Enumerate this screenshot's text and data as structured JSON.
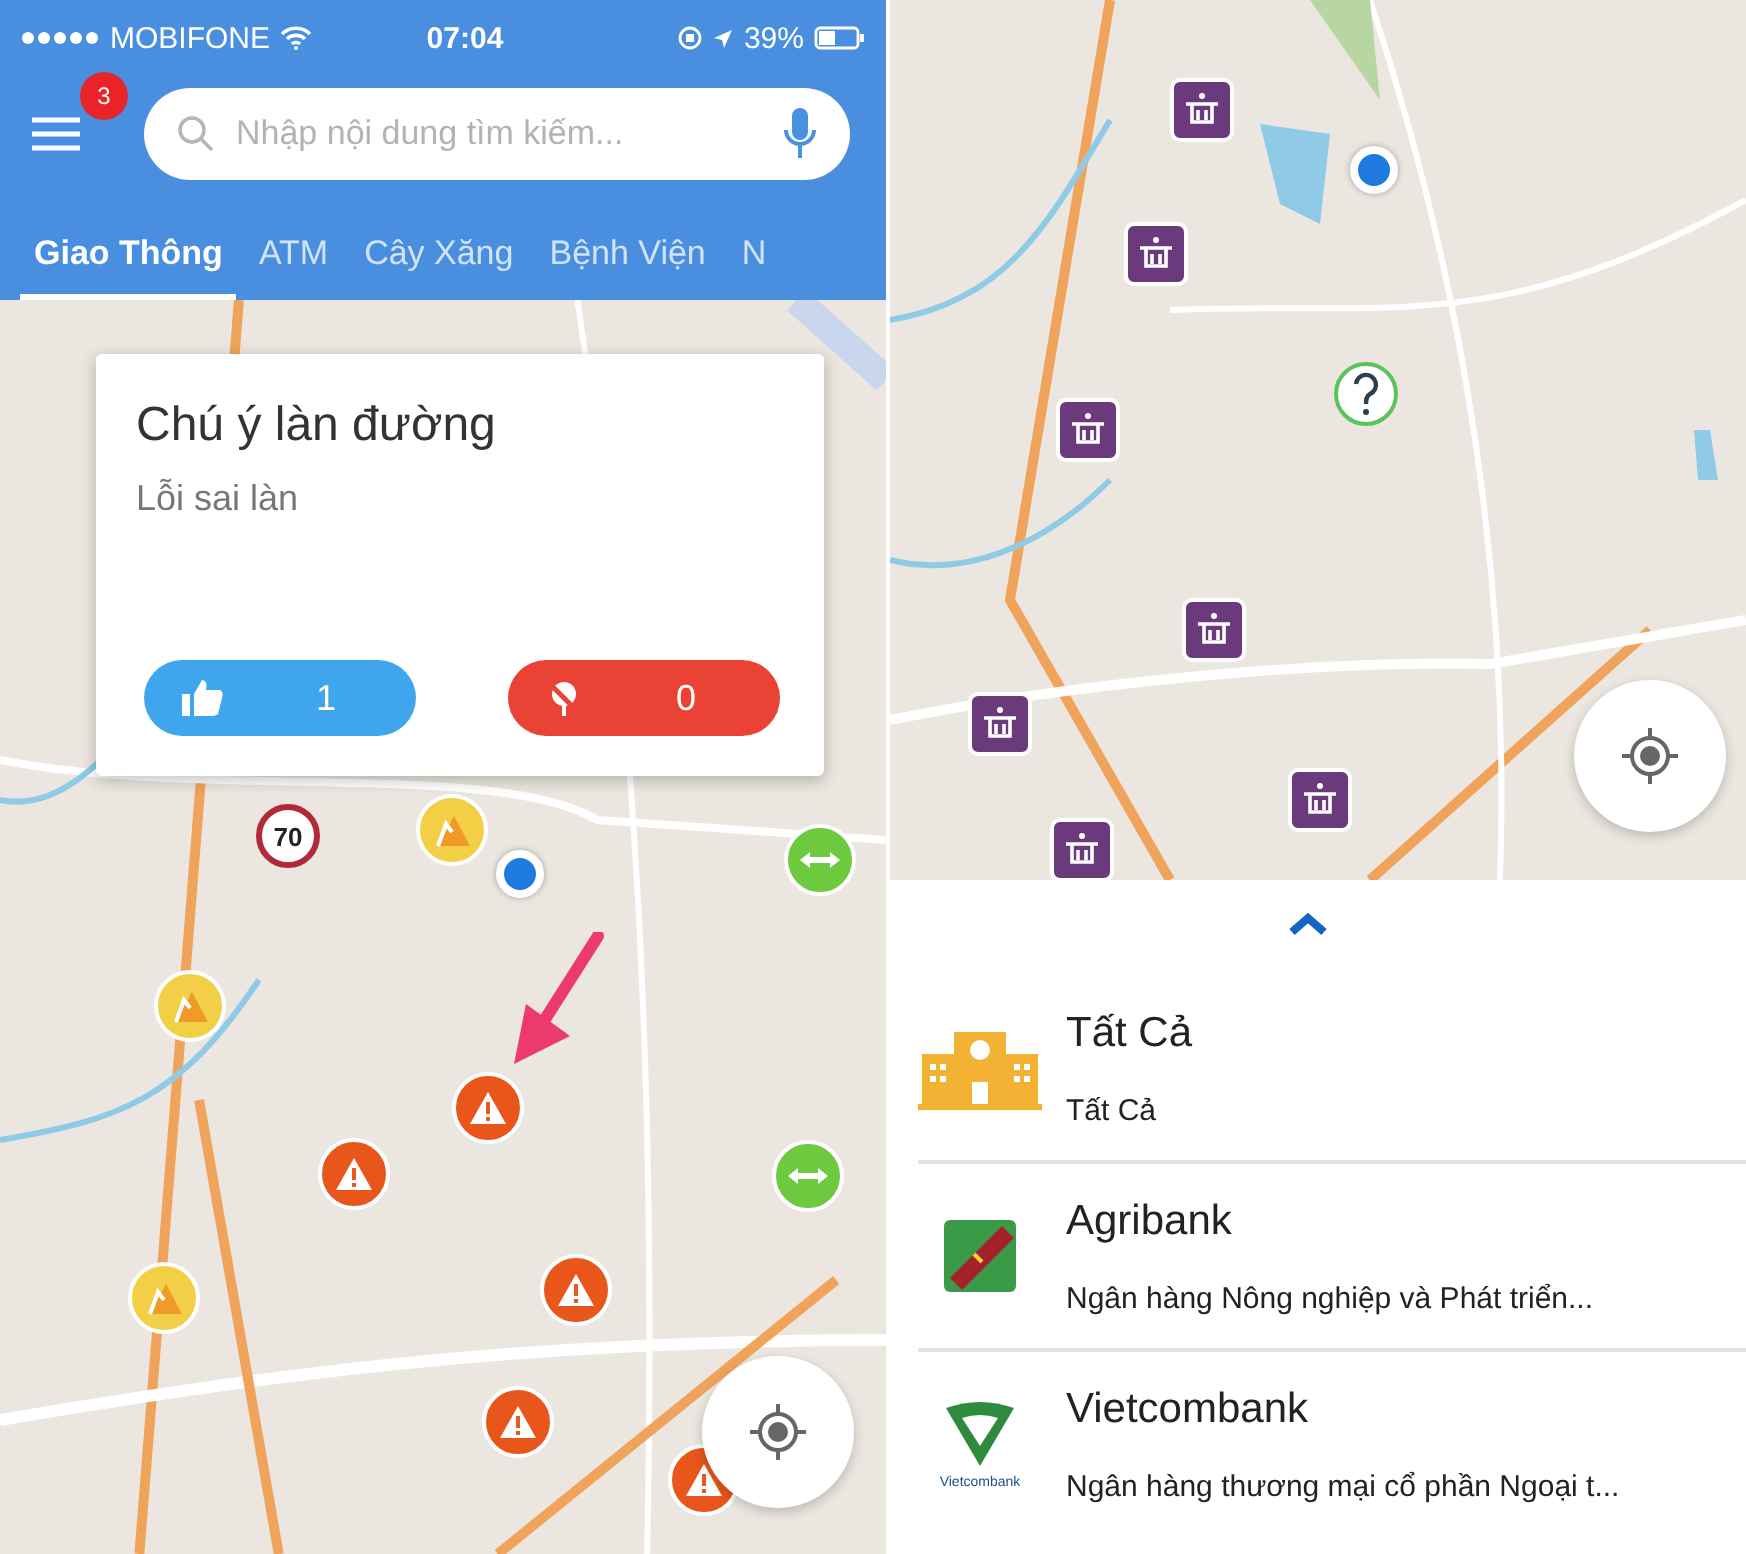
{
  "left_screen": {
    "status_bar": {
      "carrier": "MOBIFONE",
      "time": "07:04",
      "battery": "39%"
    },
    "menu_badge": "3",
    "search": {
      "placeholder": "Nhập nội dung tìm kiếm..."
    },
    "tabs": [
      {
        "label": "Giao Thông",
        "selected": true
      },
      {
        "label": "ATM",
        "selected": false
      },
      {
        "label": "Cây Xăng",
        "selected": false
      },
      {
        "label": "Bệnh Viện",
        "selected": false
      },
      {
        "label": "N",
        "selected": false
      }
    ],
    "map": {
      "kind": "picture",
      "markers": [
        {
          "kind": "speed-limit",
          "label": "70"
        },
        {
          "kind": "construction"
        },
        {
          "kind": "location"
        },
        {
          "kind": "traffic"
        },
        {
          "kind": "construction"
        },
        {
          "kind": "warning"
        },
        {
          "kind": "warning"
        },
        {
          "kind": "traffic"
        },
        {
          "kind": "construction"
        },
        {
          "kind": "warning"
        },
        {
          "kind": "warning"
        },
        {
          "kind": "warning"
        }
      ]
    },
    "popup": {
      "title": "Chú ý làn đường",
      "subtitle": "Lỗi sai làn",
      "like_count": "1",
      "dislike_count": "0"
    }
  },
  "right_screen": {
    "map": {
      "kind": "picture",
      "markers": [
        {
          "kind": "atm"
        },
        {
          "kind": "location"
        },
        {
          "kind": "atm"
        },
        {
          "kind": "unknown"
        },
        {
          "kind": "atm"
        },
        {
          "kind": "atm"
        },
        {
          "kind": "atm"
        },
        {
          "kind": "atm"
        },
        {
          "kind": "atm"
        }
      ]
    },
    "bank_list": {
      "items": [
        {
          "kind": "all",
          "name": "Tất Cả",
          "description": "Tất Cả"
        },
        {
          "kind": "agribank",
          "name": "Agribank",
          "description": "Ngân hàng Nông nghiệp và Phát triển..."
        },
        {
          "kind": "vietcombank",
          "name": "Vietcombank",
          "description": "Ngân hàng thương mại cổ phần Ngoại t...",
          "logo_label": "Vietcombank"
        }
      ]
    }
  }
}
